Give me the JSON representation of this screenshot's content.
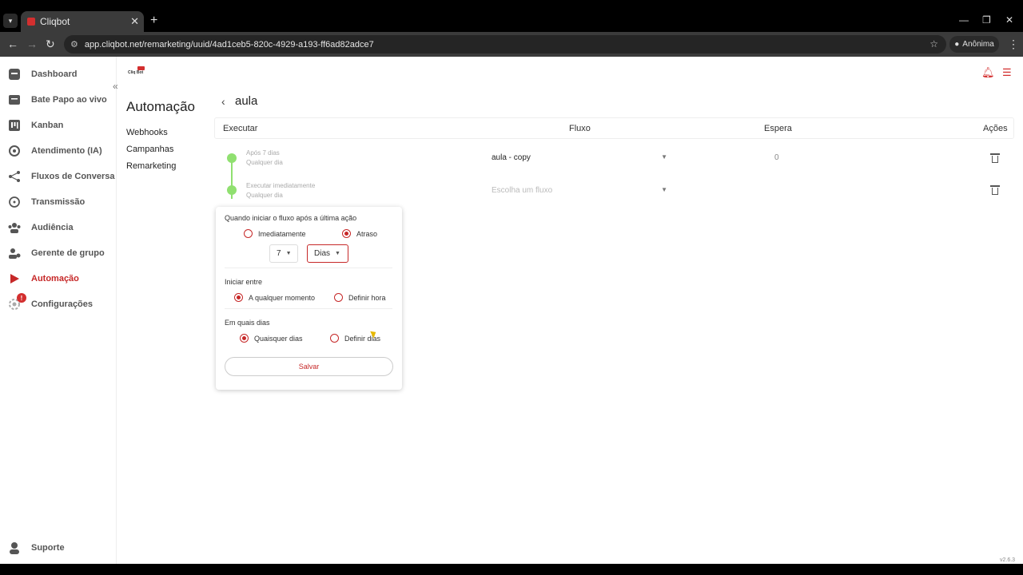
{
  "browser": {
    "tab_title": "Cliqbot",
    "url": "app.cliqbot.net/remarketing/uuid/4ad1ceb5-820c-4929-a193-ff6ad82adce7",
    "incognito_label": "Anônima"
  },
  "sidebar": {
    "items": [
      {
        "label": "Dashboard",
        "icon": "dashboard-icon"
      },
      {
        "label": "Bate Papo ao vivo",
        "icon": "chat-icon"
      },
      {
        "label": "Kanban",
        "icon": "kanban-icon"
      },
      {
        "label": "Atendimento (IA)",
        "icon": "ai-icon"
      },
      {
        "label": "Fluxos de Conversa",
        "icon": "flow-icon"
      },
      {
        "label": "Transmissão",
        "icon": "broadcast-icon"
      },
      {
        "label": "Audiência",
        "icon": "audience-icon"
      },
      {
        "label": "Gerente de grupo",
        "icon": "group-icon"
      },
      {
        "label": "Automação",
        "icon": "play-icon",
        "active": true
      },
      {
        "label": "Configurações",
        "icon": "settings-icon",
        "badge": "!"
      }
    ],
    "support_label": "Suporte",
    "logo_text": "Cliq Bot"
  },
  "section": {
    "title": "Automação",
    "nav": [
      "Webhooks",
      "Campanhas",
      "Remarketing"
    ]
  },
  "page": {
    "title": "aula"
  },
  "table": {
    "headers": {
      "execute": "Executar",
      "flow": "Fluxo",
      "wait": "Espera",
      "actions": "Ações"
    },
    "rows": [
      {
        "title": "Após 7 dias",
        "subtitle": "Qualquer dia",
        "flow": "aula - copy",
        "wait": "0"
      },
      {
        "title": "Executar imediatamente",
        "subtitle": "Qualquer dia",
        "flow_placeholder": "Escolha um fluxo",
        "wait": ""
      }
    ]
  },
  "popup": {
    "when_label": "Quando iniciar o fluxo após a última ação",
    "option_immediately": "Imediatamente",
    "option_delay": "Atraso",
    "delay_amount": "7",
    "delay_unit": "Dias",
    "start_between_label": "Iniciar entre",
    "option_any_time": "A qualquer momento",
    "option_set_time": "Definir hora",
    "which_days_label": "Em quais dias",
    "option_any_days": "Quaisquer dias",
    "option_set_days": "Definir dias",
    "save_label": "Salvar"
  },
  "version": "v2.6.3",
  "colors": {
    "accent": "#c62828",
    "timeline": "#90e070"
  }
}
